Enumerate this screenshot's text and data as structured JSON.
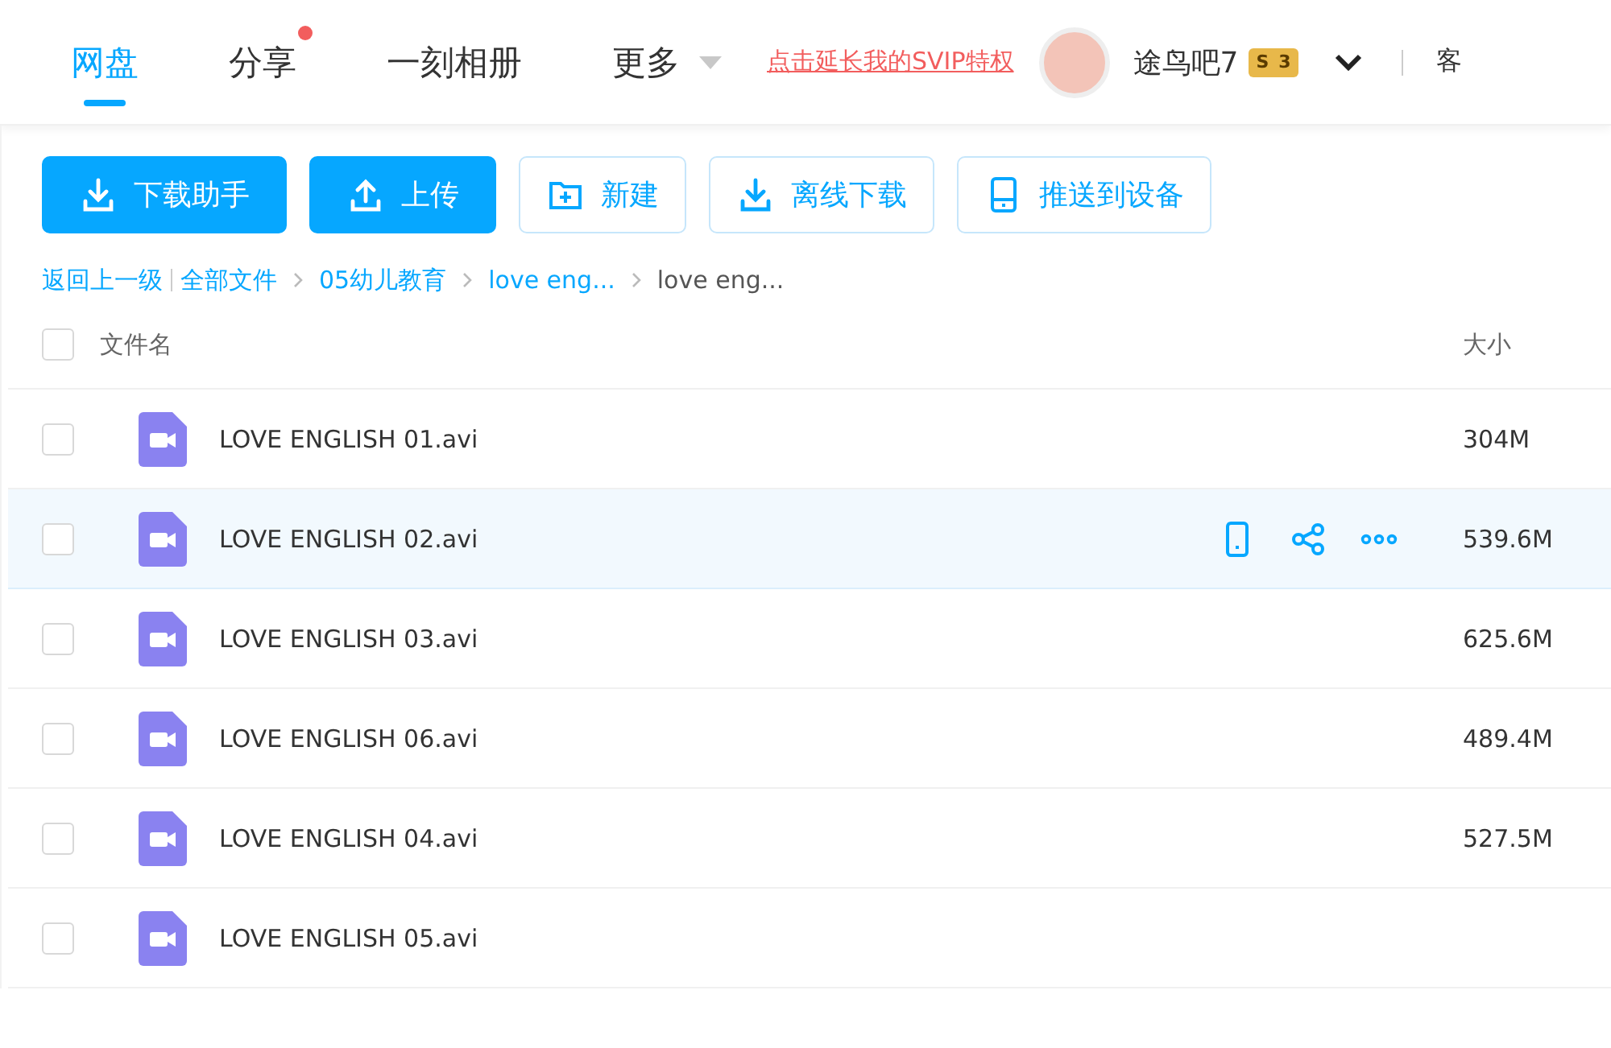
{
  "nav": {
    "tabs": [
      {
        "label": "网盘",
        "selected": true
      },
      {
        "label": "分享",
        "selected": false,
        "dot": true
      },
      {
        "label": "一刻相册",
        "selected": false
      },
      {
        "label": "更多",
        "selected": false,
        "dropdown": true
      }
    ],
    "promo_link": "点击延长我的SVIP特权",
    "user": {
      "name": "途鸟吧7",
      "badge_letter": "S",
      "badge_level": "3"
    },
    "cut_item": "客"
  },
  "toolbar": [
    {
      "label": "下载助手",
      "kind": "primary"
    },
    {
      "label": "上传",
      "kind": "primary"
    },
    {
      "label": "新建",
      "kind": "outline"
    },
    {
      "label": "离线下载",
      "kind": "outline"
    },
    {
      "label": "推送到设备",
      "kind": "outline"
    }
  ],
  "breadcrumb": {
    "back": "返回上一级",
    "items": [
      {
        "label": "全部文件",
        "current": false
      },
      {
        "label": "05幼儿教育",
        "current": false
      },
      {
        "label": "love eng...",
        "current": false
      },
      {
        "label": "love eng...",
        "current": true
      }
    ]
  },
  "table": {
    "all_checked": false,
    "columns": [
      "文件名",
      "大小"
    ],
    "rows": [
      {
        "name": "LOVE ENGLISH 01.avi",
        "size": "304M",
        "hovered": false,
        "checked": false
      },
      {
        "name": "LOVE ENGLISH 02.avi",
        "size": "539.6M",
        "hovered": true,
        "checked": false
      },
      {
        "name": "LOVE ENGLISH 03.avi",
        "size": "625.6M",
        "hovered": false,
        "checked": false
      },
      {
        "name": "LOVE ENGLISH 06.avi",
        "size": "489.4M",
        "hovered": false,
        "checked": false
      },
      {
        "name": "LOVE ENGLISH 04.avi",
        "size": "527.5M",
        "hovered": false,
        "checked": false
      },
      {
        "name": "LOVE ENGLISH 05.avi",
        "hovered": false,
        "checked": false
      }
    ]
  }
}
